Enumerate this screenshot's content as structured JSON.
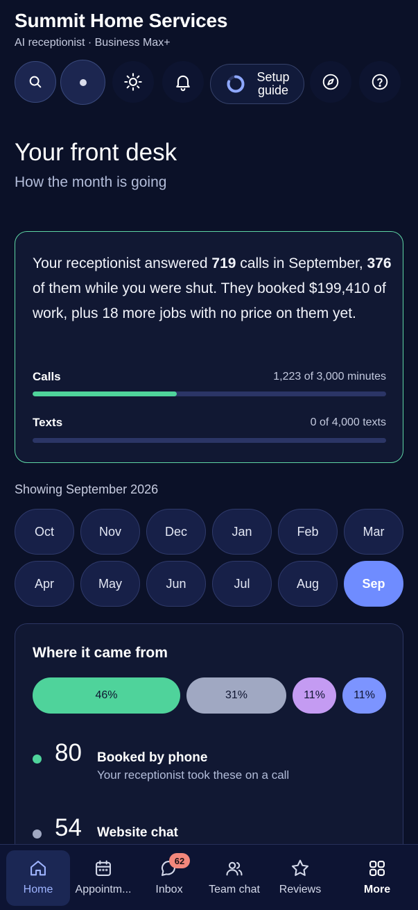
{
  "header": {
    "title": "Summit Home Services",
    "subtitle": "AI receptionist · Business Max+"
  },
  "toolbar": {
    "search_icon": "search-icon",
    "status_icon": "dot-icon",
    "theme_icon": "sun-icon",
    "notifications_icon": "bell-icon",
    "setup_label": "Setup guide",
    "setup_progress": 0.8,
    "explore_icon": "compass-icon",
    "help_icon": "help-icon"
  },
  "intro": {
    "title": "Your front desk",
    "subtitle": "How the month is going"
  },
  "summary": {
    "text_1": "Your receptionist answered ",
    "calls_answered": "719",
    "text_2": " calls in September, ",
    "calls_shut": "376",
    "text_3": " of them while you were shut. They booked $199,410 of work, plus 18 more jobs with no price on them yet.",
    "calls_label": "Calls",
    "calls_value": "1,223 of 3,000 minutes",
    "calls_fraction": 0.4077,
    "texts_label": "Texts",
    "texts_value": "0 of 4,000 texts",
    "texts_fraction": 0
  },
  "months": {
    "showing": "Showing September 2026",
    "items": [
      "Oct",
      "Nov",
      "Dec",
      "Jan",
      "Feb",
      "Mar",
      "Apr",
      "May",
      "Jun",
      "Jul",
      "Aug",
      "Sep"
    ],
    "selected": "Sep"
  },
  "sources": {
    "title": "Where it came from",
    "segments": [
      {
        "label": "46%",
        "color": "#4fd39b"
      },
      {
        "label": "31%",
        "color": "#a0a8c2"
      },
      {
        "label": "11%",
        "color": "#c49bf2"
      },
      {
        "label": "11%",
        "color": "#7c94ff"
      }
    ],
    "rows": [
      {
        "count": "80",
        "name": "Booked by phone",
        "desc": "Your receptionist took these on a call",
        "color": "#4fd39b"
      },
      {
        "count": "54",
        "name": "Website chat",
        "desc": "",
        "color": "#a0a8c2"
      }
    ]
  },
  "nav": {
    "items": [
      {
        "label": "Home",
        "icon": "home-icon"
      },
      {
        "label": "Appointm...",
        "icon": "calendar-icon"
      },
      {
        "label": "Inbox",
        "icon": "chat-bubble-icon",
        "badge": "62"
      },
      {
        "label": "Team chat",
        "icon": "team-icon"
      },
      {
        "label": "Reviews",
        "icon": "star-icon"
      },
      {
        "label": "More",
        "icon": "grid-icon"
      }
    ]
  }
}
